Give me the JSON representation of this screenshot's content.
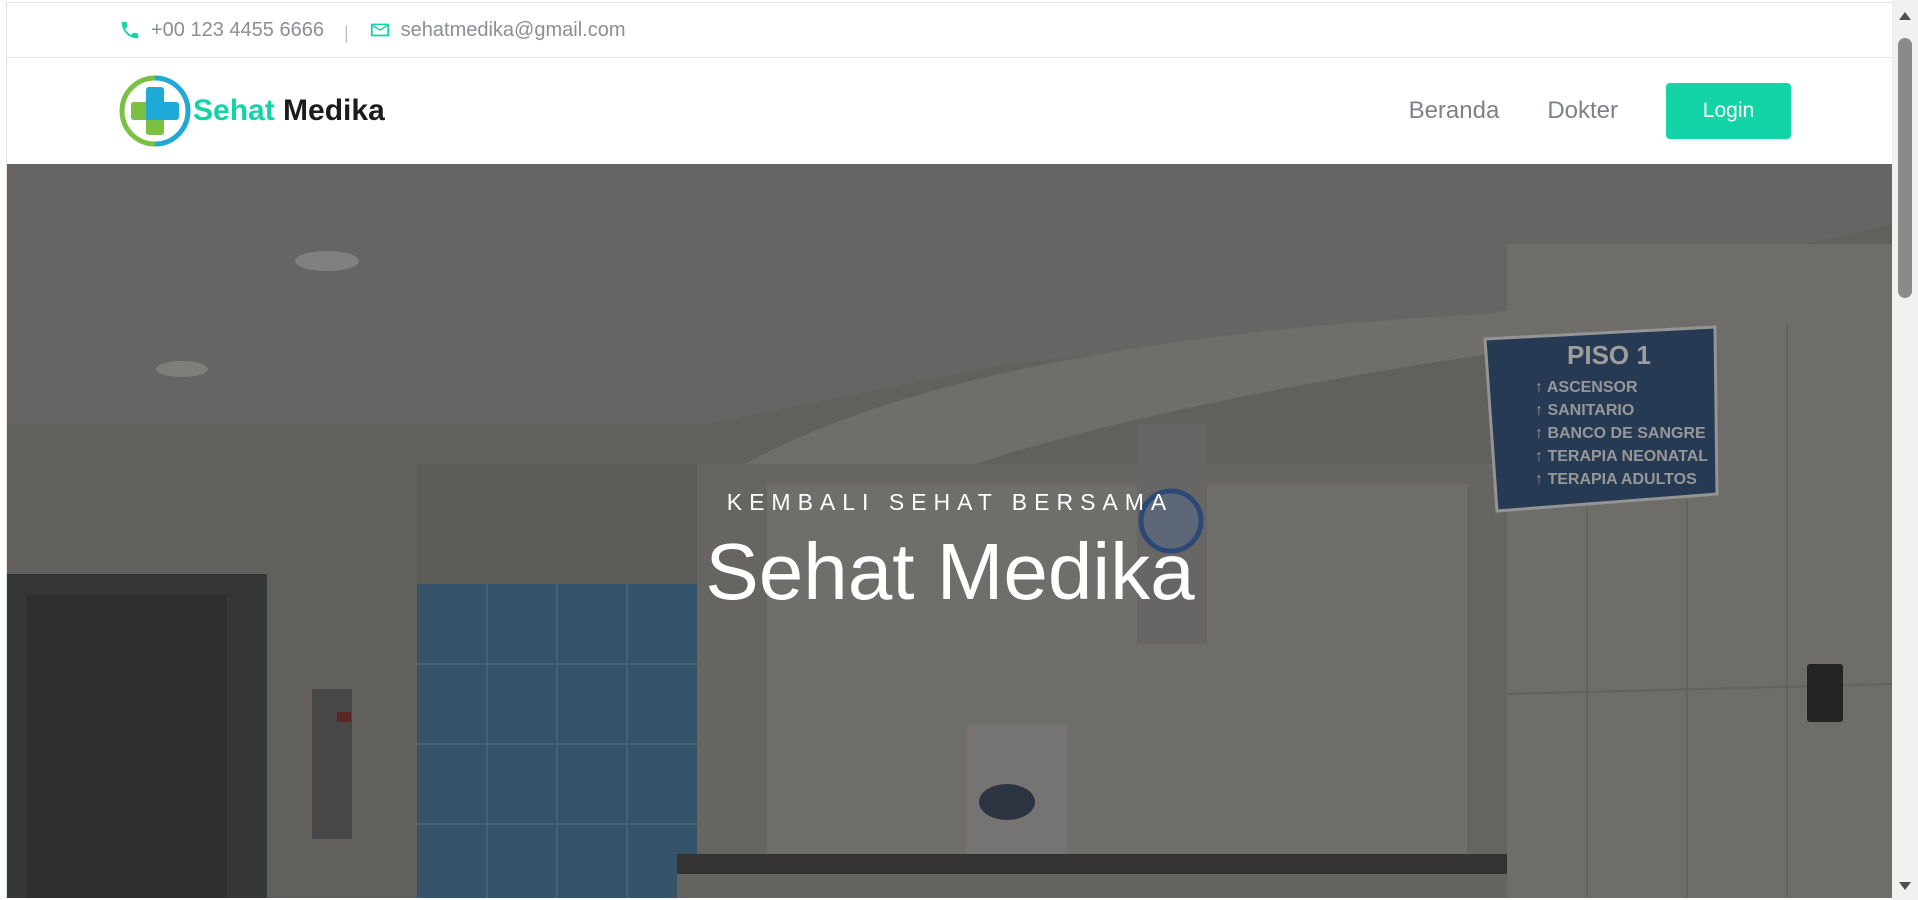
{
  "topbar": {
    "phone": "+00 123 4455 6666",
    "separator": "|",
    "email": "sehatmedika@gmail.com",
    "phone_icon": "phone-icon",
    "email_icon": "mail-icon"
  },
  "brand": {
    "name_part1": "Sehat",
    "name_part2": "Medika",
    "logo_icon": "medical-cross-logo-icon"
  },
  "nav": {
    "items": [
      {
        "label": "Beranda"
      },
      {
        "label": "Dokter"
      }
    ],
    "login_label": "Login"
  },
  "hero": {
    "subtitle": "KEMBALI SEHAT BERSAMA",
    "title": "Sehat Medika",
    "sign": {
      "heading": "PISO 1",
      "lines": [
        "ASCENSOR",
        "SANITARIO",
        "BANCO DE SANGRE",
        "TERAPIA NEONATAL",
        "TERAPIA ADULTOS"
      ]
    }
  },
  "colors": {
    "accent": "#13d4a6",
    "brand_dark": "#1c1c1c",
    "muted_text": "#8a8f96"
  }
}
